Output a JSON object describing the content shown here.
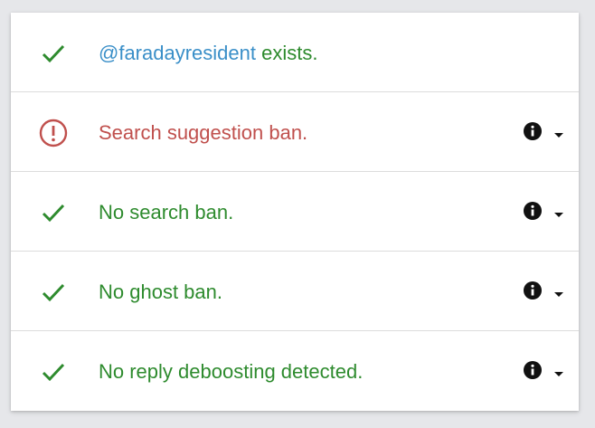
{
  "colors": {
    "success": "#2e8b2e",
    "error": "#c0504d",
    "handle": "#3a8fc8"
  },
  "rows": [
    {
      "status": "ok",
      "icon": "check-icon",
      "handle": "@faradayresident",
      "text": " exists.",
      "has_info": false
    },
    {
      "status": "bad",
      "icon": "alert-circle-icon",
      "text": "Search suggestion ban.",
      "has_info": true
    },
    {
      "status": "ok",
      "icon": "check-icon",
      "text": "No search ban.",
      "has_info": true
    },
    {
      "status": "ok",
      "icon": "check-icon",
      "text": "No ghost ban.",
      "has_info": true
    },
    {
      "status": "ok",
      "icon": "check-icon",
      "text": "No reply deboosting detected.",
      "has_info": true
    }
  ]
}
